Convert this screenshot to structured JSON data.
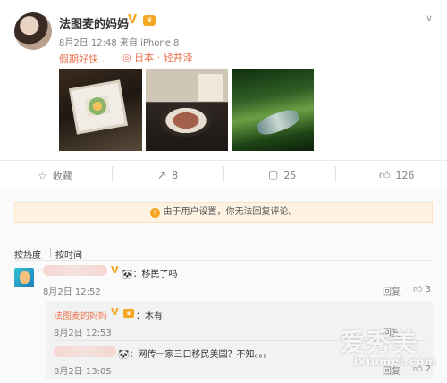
{
  "post": {
    "username": "法图麦的妈妈",
    "verified_badge": "V",
    "level_badge": "♛",
    "date": "8月2日 12:48",
    "source_prefix": "来自",
    "source": "iPhone 8",
    "text": "假期好快...",
    "location_icon": "location-pin-icon",
    "location": "日本 · 轻井泽"
  },
  "actions": {
    "collect_label": "收藏",
    "share_count": "8",
    "comment_count": "25",
    "like_count": "126"
  },
  "notice": {
    "text": "由于用户设置，你无法回复评论。",
    "icon": "!"
  },
  "sort": {
    "by_hot": "按热度",
    "by_time": "按时间"
  },
  "comments": [
    {
      "emoji": "🐼",
      "text": "：移民了吗",
      "time": "8月2日 12:52",
      "reply_label": "回复",
      "like_count": "3",
      "replies": [
        {
          "username": "法图麦的妈妈",
          "text": "：木有",
          "time": "8月2日 12:53",
          "reply_label": "回复"
        },
        {
          "emoji": "🐼",
          "text": "：网传一家三口移民美国？不知。。。",
          "time": "8月2日 13:05",
          "reply_label": "回复",
          "like_count": "2"
        }
      ]
    }
  ],
  "watermark": {
    "main": "爱秀美",
    "sub": "ixiumei.com"
  },
  "colors": {
    "accent": "#eb7350",
    "badge": "#f5a623",
    "muted": "#808080"
  }
}
